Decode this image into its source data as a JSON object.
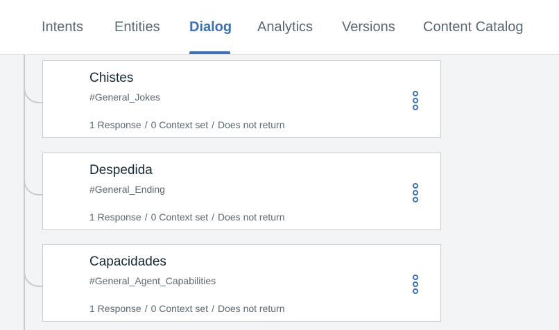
{
  "tabs": [
    {
      "label": "Intents",
      "active": false
    },
    {
      "label": "Entities",
      "active": false
    },
    {
      "label": "Dialog",
      "active": true
    },
    {
      "label": "Analytics",
      "active": false
    },
    {
      "label": "Versions",
      "active": false
    },
    {
      "label": "Content Catalog",
      "active": false
    }
  ],
  "nodes": [
    {
      "title": "Chistes",
      "condition": "#General_Jokes",
      "responses": "1 Response",
      "context": "0 Context set",
      "returns": "Does not return",
      "separator": "/",
      "menu_icon": "more-vertical-icon"
    },
    {
      "title": "Despedida",
      "condition": "#General_Ending",
      "responses": "1 Response",
      "context": "0 Context set",
      "returns": "Does not return",
      "separator": "/",
      "menu_icon": "more-vertical-icon"
    },
    {
      "title": "Capacidades",
      "condition": "#General_Agent_Capabilities",
      "responses": "1 Response",
      "context": "0 Context set",
      "returns": "Does not return",
      "separator": "/",
      "menu_icon": "more-vertical-icon"
    }
  ],
  "colors": {
    "accent": "#3d70b2",
    "background": "#f3f4f6",
    "card_border": "#c7ccd1"
  }
}
